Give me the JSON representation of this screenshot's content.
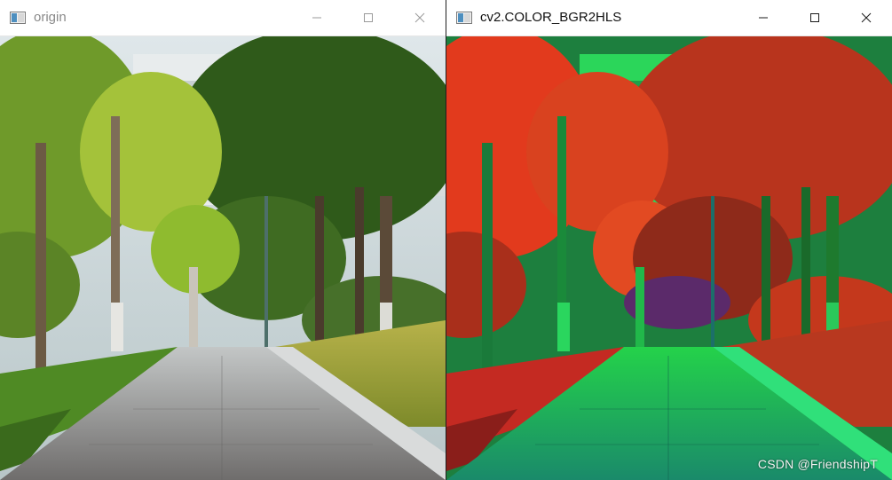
{
  "windows": {
    "left": {
      "title": "origin",
      "controls": [
        "minimize",
        "maximize",
        "close"
      ]
    },
    "right": {
      "title": "cv2.COLOR_BGR2HLS",
      "controls": [
        "minimize",
        "maximize",
        "close"
      ],
      "watermark": "CSDN @FriendshipT"
    }
  },
  "icons": {
    "app": "window-app-icon",
    "minimize": "minimize-icon",
    "maximize": "maximize-icon",
    "close": "close-icon"
  },
  "colors": {
    "titlebar_bg": "#ffffff",
    "inactive_title": "#8a8a8a",
    "active_title": "#111111",
    "origin_palette": [
      "#6f9a2a",
      "#2f5a1a",
      "#a9b8b9",
      "#c6d56c"
    ],
    "hls_palette": [
      "#e23a1d",
      "#23c63a",
      "#1ea07b",
      "#8e2a1a"
    ]
  }
}
